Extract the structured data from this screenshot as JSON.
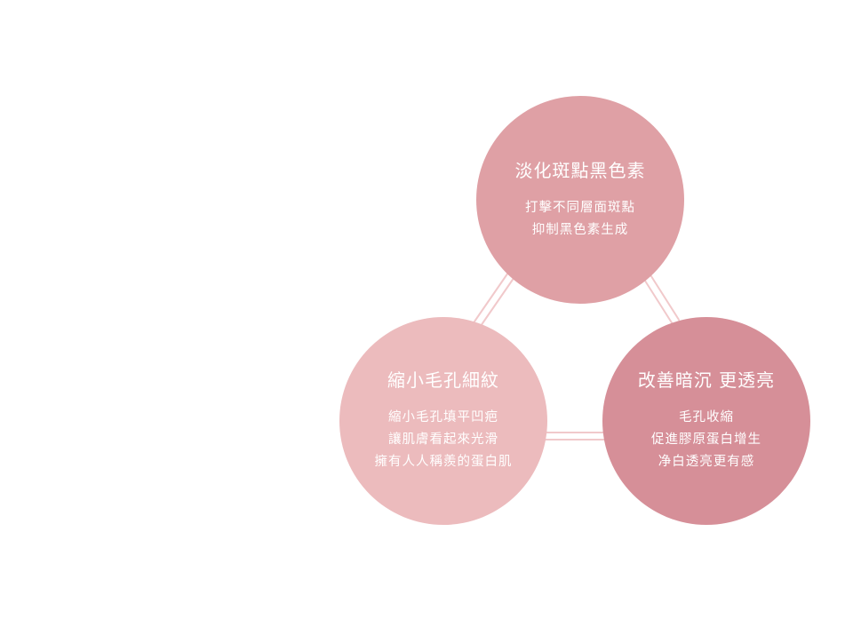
{
  "connector_color": "#f1c9cb",
  "nodes": [
    {
      "title": "淡化斑點黑色素",
      "lines": [
        "打擊不同層面斑點",
        "抑制黑色素生成"
      ],
      "color": "#dfa0a5"
    },
    {
      "title": "縮小毛孔細紋",
      "lines": [
        "縮小毛孔填平凹疤",
        "讓肌膚看起來光滑",
        "擁有人人稱羨的蛋白肌"
      ],
      "color": "#ecbbbd"
    },
    {
      "title": "改善暗沉 更透亮",
      "lines": [
        "毛孔收縮",
        "促進膠原蛋白增生",
        "净白透亮更有感"
      ],
      "color": "#d68f98"
    }
  ]
}
